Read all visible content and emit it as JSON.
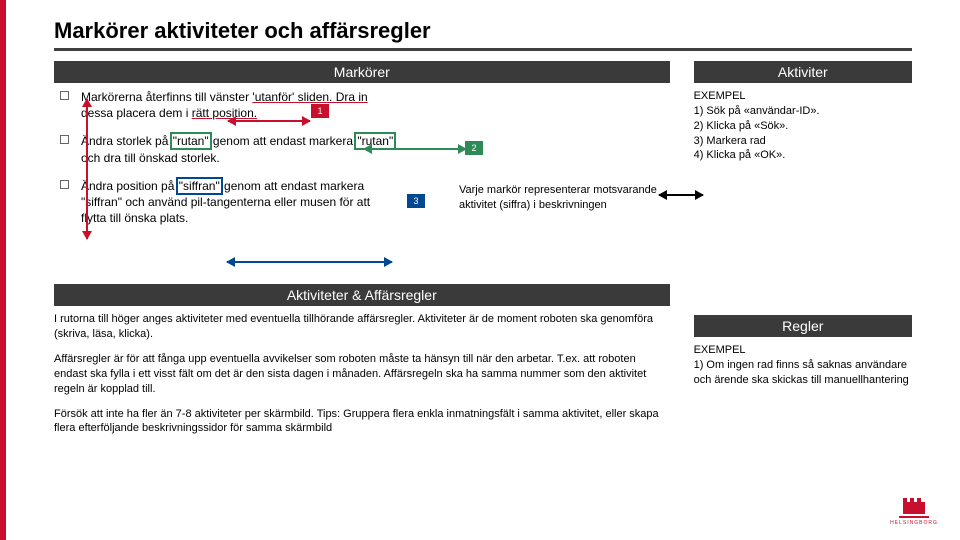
{
  "title": "Markörer aktiviteter och affärsregler",
  "left": {
    "bar1": "Markörer",
    "bullets": [
      {
        "pre": "Markörerna återfinns till vänster ",
        "red": "'utanför' sliden. Dra in",
        "post1": " dessa placera dem i ",
        "red2": "rätt position.",
        "num": "1"
      },
      {
        "pre": "Ändra storlek på ",
        "green": "\"rutan\"",
        "mid": " genom att endast markera ",
        "green2": "\"rutan\"",
        "post": " och dra till önskad storlek.",
        "num": "2"
      },
      {
        "pre": "Ändra position på ",
        "blue": "\"siffran\"",
        "post": " genom att endast markera \"siffran\" och använd pil-tangenterna eller musen för att flytta till önska plats.",
        "num": "3"
      }
    ],
    "sideNote": "Varje markör representerar motsvarande aktivitet (siffra) i beskrivningen",
    "bar2": "Aktiviteter & Affärsregler",
    "para1": "I rutorna till höger anges aktiviteter med eventuella tillhörande affärsregler. Aktiviteter är de moment roboten ska genomföra (skriva, läsa, klicka).",
    "para2": "Affärsregler är för att fånga upp eventuella avvikelser som roboten måste ta hänsyn till när den arbetar. T.ex. att roboten endast ska fylla i ett visst fält om det är den sista dagen i månaden. Affärsregeln ska ha samma nummer som den aktivitet regeln är kopplad till.",
    "para3": "Försök att inte ha fler än 7-8 aktiviteter per skärmbild. Tips: Gruppera flera enkla inmatningsfält i samma aktivitet, eller skapa flera efterföljande beskrivningssidor för samma skärmbild"
  },
  "right": {
    "bar1": "Aktiviter",
    "example1": "EXEMPEL\n1) Sök på «användar-ID».\n2) Klicka på «Sök».\n3) Markera rad\n4) Klicka på «OK».",
    "bar2": "Regler",
    "example2": "EXEMPEL\n1) Om ingen rad finns så saknas användare och ärende ska skickas till manuellhantering"
  },
  "logoText": "HELSINGBORG"
}
